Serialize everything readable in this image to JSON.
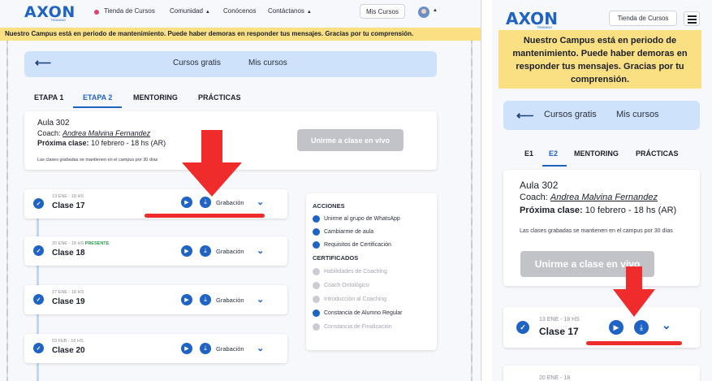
{
  "brand": {
    "logo_text": "AXON",
    "logo_sub": "TRAINING"
  },
  "nav": {
    "tienda": "Tienda de Cursos",
    "comunidad": "Comunidad",
    "conocenos": "Conócenos",
    "contactanos": "Contáctanos",
    "mis_cursos": "Mis Cursos"
  },
  "banner": "Nuestro Campus está en periodo de mantenimiento. Puede haber demoras en responder tus mensajes. Gracias por tu comprensión.",
  "header": {
    "cursos_gratis": "Cursos gratis",
    "mis_cursos": "Mis cursos"
  },
  "tabs_desktop": [
    "ETAPA 1",
    "ETAPA 2",
    "MENTORING",
    "PRÁCTICAS"
  ],
  "tabs_mobile": [
    "E1",
    "E2",
    "MENTORING",
    "PRÁCTICAS"
  ],
  "aula": {
    "title": "Aula 302",
    "coach_label": "Coach:",
    "coach_name": "Andrea Malvina Fernandez",
    "next_label": "Próxima clase:",
    "next_value": "10 febrero - 18 hs (AR)",
    "note": "Las clases grabadas se mantienen en el campus por 30 días",
    "join_button": "Unirme a clase en vivo"
  },
  "classes": [
    {
      "date": "13 ENE - 18 HS",
      "present": "",
      "name": "Clase 17",
      "recording": "Grabación"
    },
    {
      "date": "20 ENE - 18 HS",
      "present": "PRESENTE",
      "name": "Clase 18",
      "recording": "Grabación"
    },
    {
      "date": "27 ENE - 18 HS",
      "present": "",
      "name": "Clase 19",
      "recording": "Grabación"
    },
    {
      "date": "03 FEB - 18 HS",
      "present": "",
      "name": "Clase 20",
      "recording": "Grabación"
    }
  ],
  "acciones": {
    "title": "ACCIONES",
    "items": [
      "Unirme al grupo de WhatsApp",
      "Cambiarme de aula",
      "Requisitos de Certificación"
    ],
    "cert_title": "CERTIFICADOS",
    "certs": [
      {
        "label": "Habilidades de Coaching",
        "enabled": false
      },
      {
        "label": "Coach Ontológico",
        "enabled": false
      },
      {
        "label": "Introducción al Coaching",
        "enabled": false
      },
      {
        "label": "Constancia de Alumno Regular",
        "enabled": true
      },
      {
        "label": "Constancia de Finalización",
        "enabled": false
      }
    ]
  },
  "mobile_partial_date": "20 ENE - 18",
  "colors": {
    "brand_blue": "#1f63c4",
    "banner_yellow": "#fae083",
    "header_blue": "#cfe2fb",
    "annotation_red": "#ef2b2b"
  },
  "icons": [
    "back-arrow-icon",
    "play-icon",
    "download-icon",
    "chevron-down-icon",
    "check-icon",
    "whatsapp-icon",
    "swap-icon",
    "certificate-icon",
    "hamburger-icon"
  ]
}
